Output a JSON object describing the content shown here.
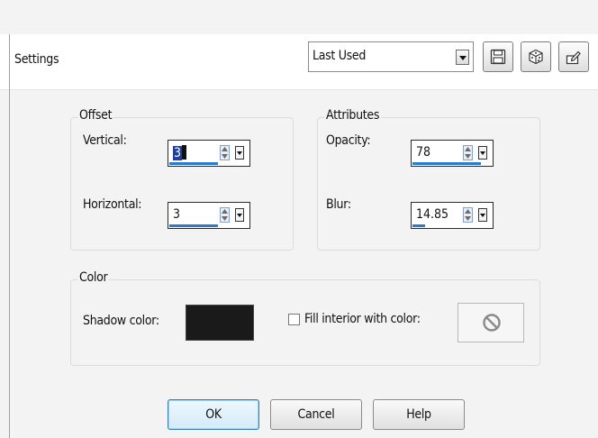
{
  "settings": {
    "label": "Settings",
    "preset": "Last Used"
  },
  "toolbar": {
    "save_icon": "save-disk-icon",
    "random_icon": "dice-icon",
    "reset_icon": "reset-icon"
  },
  "offset": {
    "title": "Offset",
    "vertical_label": "Vertical:",
    "vertical_value": "3",
    "horizontal_label": "Horizontal:",
    "horizontal_value": "3"
  },
  "attributes": {
    "title": "Attributes",
    "opacity_label": "Opacity:",
    "opacity_value": "78",
    "blur_label": "Blur:",
    "blur_value": "14.85"
  },
  "color": {
    "title": "Color",
    "shadow_label": "Shadow color:",
    "shadow_color": "#1a1a1a",
    "fill_label": "Fill interior with color:",
    "fill_checked": false
  },
  "buttons": {
    "ok": "OK",
    "cancel": "Cancel",
    "help": "Help"
  },
  "colors": {
    "accent_blue": "#2a7ad5",
    "dialog_bg": "#f3f3f3"
  }
}
